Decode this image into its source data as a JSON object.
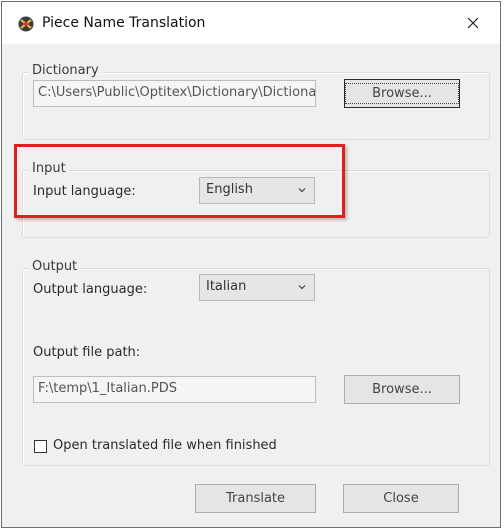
{
  "window": {
    "title": "Piece Name Translation"
  },
  "dictionary": {
    "group_label": "Dictionary",
    "path_value": "C:\\Users\\Public\\Optitex\\Dictionary\\Dictionary...",
    "browse_label": "Browse..."
  },
  "input": {
    "group_label": "Input",
    "language_label": "Input language:",
    "language_value": "English"
  },
  "output": {
    "group_label": "Output",
    "language_label": "Output language:",
    "language_value": "Italian",
    "file_path_label": "Output file path:",
    "file_path_value": "F:\\temp\\1_Italian.PDS",
    "browse_label": "Browse...",
    "open_checkbox_label": "Open translated file when finished",
    "open_checkbox_checked": false
  },
  "actions": {
    "translate_label": "Translate",
    "close_label": "Close"
  },
  "colors": {
    "highlight": "#e21d1d"
  }
}
